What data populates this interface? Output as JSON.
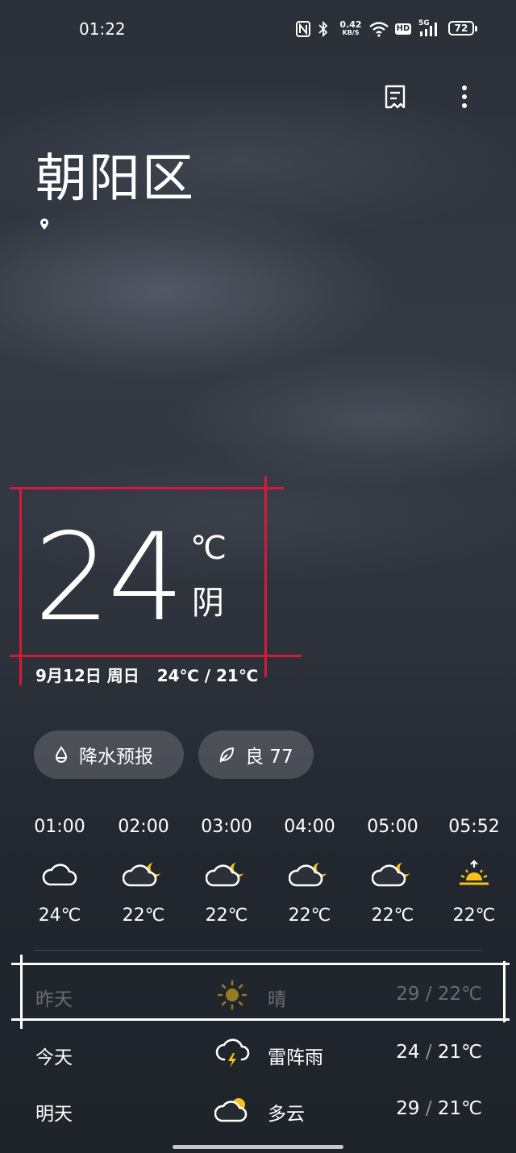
{
  "status_bar": {
    "time": "01:22",
    "net_speed_value": "0.42",
    "net_speed_unit": "KB/S",
    "hd_label": "HD",
    "signal_label": "5G",
    "battery": "72"
  },
  "header": {
    "city": "朝阳区",
    "icons": [
      "city-list-icon",
      "more-icon",
      "location-icon"
    ]
  },
  "current": {
    "temperature": "24",
    "unit": "℃",
    "condition": "阴",
    "date": "9月12日 周日",
    "range": "24℃ / 21℃"
  },
  "pills": {
    "precip_label": "降水预报",
    "aqi_label": "良 77"
  },
  "hourly": [
    {
      "time": "01:00",
      "icon": "cloudy-icon",
      "temp": "24℃"
    },
    {
      "time": "02:00",
      "icon": "cloudy-night-icon",
      "temp": "22℃"
    },
    {
      "time": "03:00",
      "icon": "cloudy-night-icon",
      "temp": "22℃"
    },
    {
      "time": "04:00",
      "icon": "cloudy-night-icon",
      "temp": "22℃"
    },
    {
      "time": "05:00",
      "icon": "cloudy-night-icon",
      "temp": "22℃"
    },
    {
      "time": "05:52",
      "icon": "sunrise-icon",
      "temp": "22℃"
    }
  ],
  "daily": [
    {
      "label": "昨天",
      "icon": "sunny-icon",
      "condition": "晴",
      "high": "29",
      "low": "22℃"
    },
    {
      "label": "今天",
      "icon": "thunderstorm-icon",
      "condition": "雷阵雨",
      "high": "24",
      "low": "21℃"
    },
    {
      "label": "明天",
      "icon": "partly-cloudy-icon",
      "condition": "多云",
      "high": "29",
      "low": "21℃"
    }
  ],
  "colors": {
    "annotation_red": "#d8193b",
    "annotation_white": "#ffffff",
    "sun_yellow": "#f5c21b",
    "pill_bg": "rgba(255,255,255,0.17)"
  }
}
